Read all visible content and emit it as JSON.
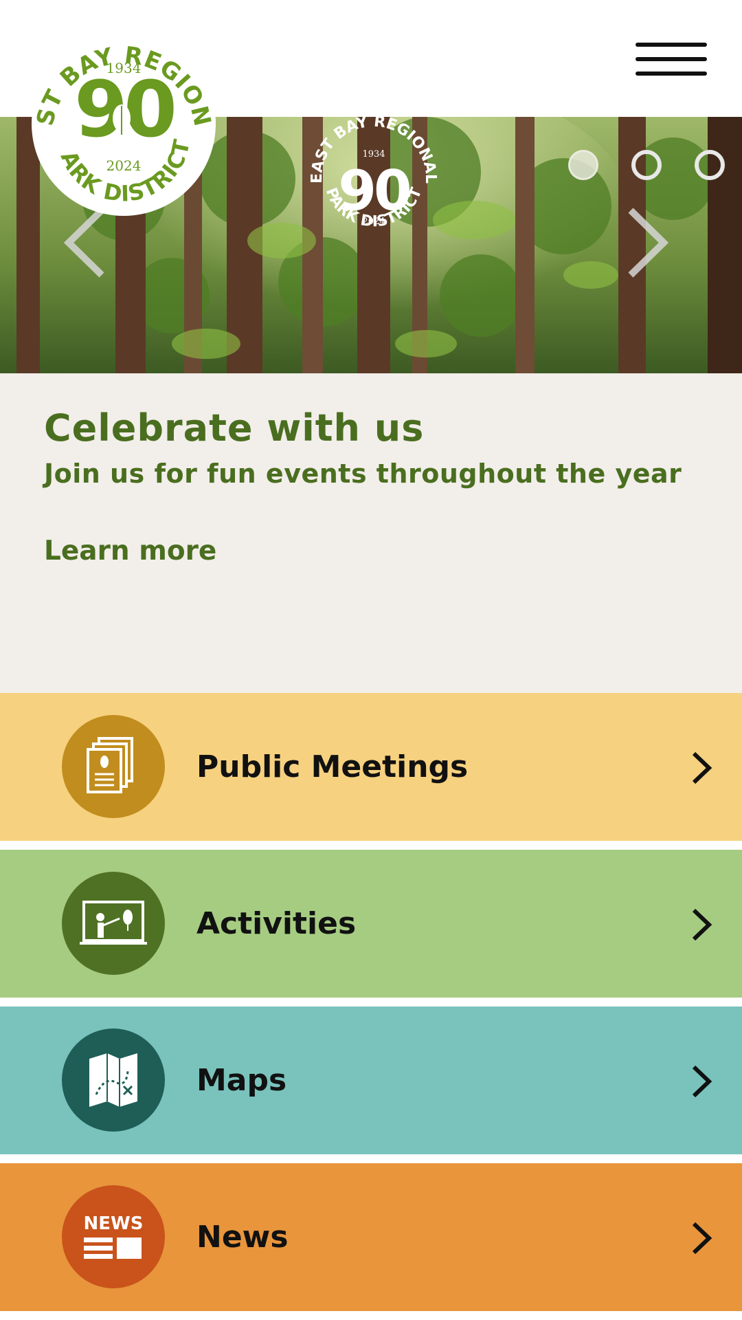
{
  "header": {
    "logo": {
      "arc_top": "EAST BAY REGIONAL",
      "arc_bottom": "PARK DISTRICT",
      "year_start": "1934",
      "number": "90",
      "year_end": "2024"
    },
    "menu_icon": "hamburger-icon"
  },
  "hero": {
    "slides": 3,
    "active_slide": 1,
    "prev_icon": "chevron-left-icon",
    "next_icon": "chevron-right-icon"
  },
  "intro": {
    "title": "Celebrate with us",
    "subtitle": "Join us for fun events throughout the year",
    "link": "Learn more"
  },
  "tiles": [
    {
      "label": "Public Meetings",
      "icon": "documents-icon",
      "color": "#f6d17f",
      "icon_color": "#c18d1e"
    },
    {
      "label": "Activities",
      "icon": "classroom-icon",
      "color": "#a6cc82",
      "icon_color": "#4f7124"
    },
    {
      "label": "Maps",
      "icon": "map-icon",
      "color": "#79c3bc",
      "icon_color": "#1e5e57"
    },
    {
      "label": "News",
      "icon": "news-icon",
      "color": "#e8953c",
      "icon_color": "#c9531b",
      "icon_text": "NEWS"
    }
  ]
}
